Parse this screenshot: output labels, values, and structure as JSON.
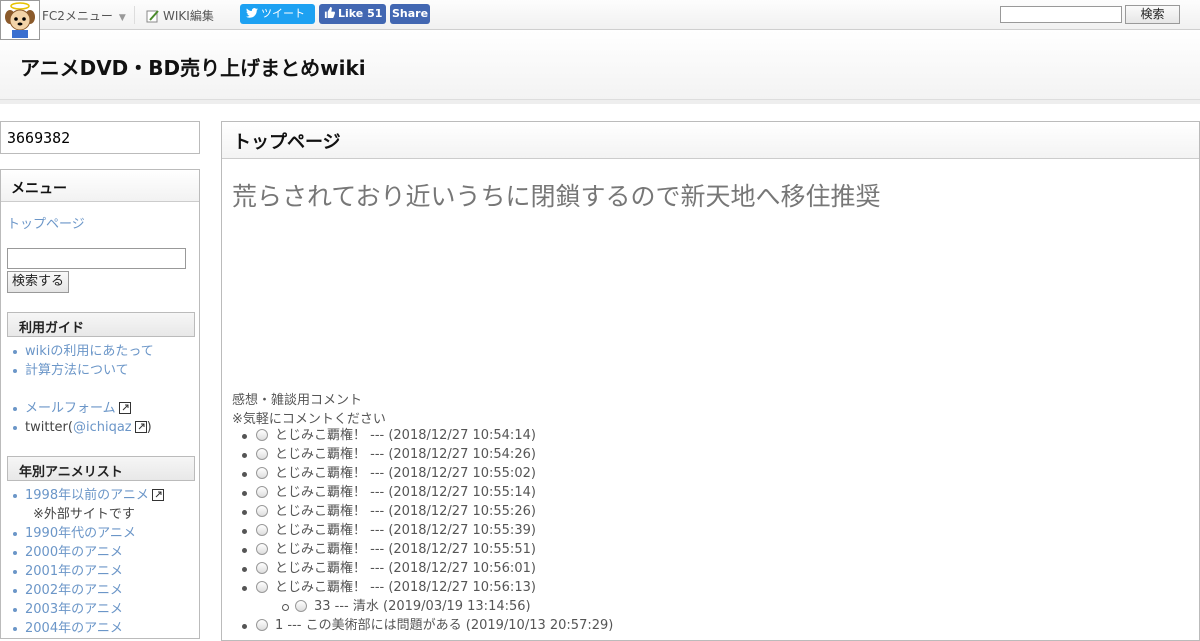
{
  "topbar": {
    "fc2_menu": "FC2メニュー",
    "wiki_edit": "WIKI編集",
    "tweet": "ツイート",
    "like": "Like 51",
    "share": "Share",
    "search_button": "検索",
    "search_value": ""
  },
  "header": {
    "title": "アニメDVD・BD売り上げまとめwiki"
  },
  "counter": {
    "value": "3669382"
  },
  "sidebar": {
    "menu_title": "メニュー",
    "top_link": "トップページ",
    "search_button": "検索する",
    "guide_title": "利用ガイド",
    "guide_items": [
      "wikiの利用にあたって",
      "計算方法について"
    ],
    "mail_form": "メールフォーム",
    "twitter_prefix": "twitter(",
    "twitter_handle": "@ichiqaz",
    "twitter_suffix": ")",
    "yearly_title": "年別アニメリスト",
    "yearly_items": [
      "1998年以前のアニメ",
      "※外部サイトです",
      "1990年代のアニメ",
      "2000年のアニメ",
      "2001年のアニメ",
      "2002年のアニメ",
      "2003年のアニメ",
      "2004年のアニメ"
    ]
  },
  "main": {
    "title": "トップページ",
    "notice": "荒らされており近いうちに閉鎖するので新天地へ移住推奨",
    "comment_label_1": "感想・雑談用コメント",
    "comment_label_2": "※気軽にコメントください",
    "comments": [
      "とじみこ覇権！ --- (2018/12/27 10:54:14)",
      "とじみこ覇権！ --- (2018/12/27 10:54:26)",
      "とじみこ覇権！ --- (2018/12/27 10:55:02)",
      "とじみこ覇権！ --- (2018/12/27 10:55:14)",
      "とじみこ覇権！ --- (2018/12/27 10:55:26)",
      "とじみこ覇権！ --- (2018/12/27 10:55:39)",
      "とじみこ覇権！ --- (2018/12/27 10:55:51)",
      "とじみこ覇権！ --- (2018/12/27 10:56:01)",
      "とじみこ覇権！ --- (2018/12/27 10:56:13)"
    ],
    "reply": "33 --- 清水 (2019/03/19 13:14:56)",
    "last_comment": "1 --- この美術部には問題がある (2019/10/13 20:57:29)"
  },
  "colors": {
    "link": "#6b96c8",
    "twitter": "#1da1f2",
    "facebook": "#4267b2"
  }
}
